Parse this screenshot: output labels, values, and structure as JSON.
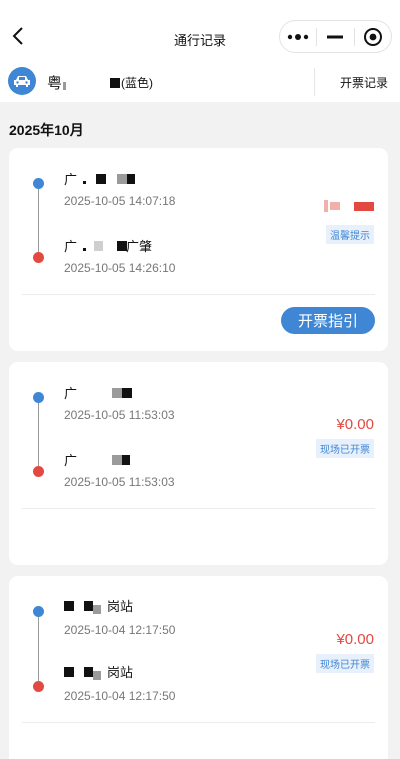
{
  "nav": {
    "title": "通行记录"
  },
  "vehicle": {
    "plate_prefix": "粤",
    "plate_color": "(蓝色)",
    "invoice_link": "开票记录"
  },
  "month_header": "2025年10月",
  "records": [
    {
      "entry_station": "广",
      "entry_time": "2025-10-05 14:07:18",
      "exit_station": "广",
      "exit_station_suffix": "广肇",
      "exit_time": "2025-10-05 14:26:10",
      "badge": "温馨提示",
      "action": "开票指引"
    },
    {
      "entry_station": "广",
      "entry_time": "2025-10-05 11:53:03",
      "exit_station": "广",
      "exit_time": "2025-10-05 11:53:03",
      "amount": "¥0.00",
      "badge": "现场已开票"
    },
    {
      "entry_station_suffix": "岗站",
      "entry_time": "2025-10-04 12:17:50",
      "exit_station_suffix": "岗站",
      "exit_time": "2025-10-04 12:17:50",
      "amount": "¥0.00",
      "badge": "现场已开票"
    }
  ]
}
